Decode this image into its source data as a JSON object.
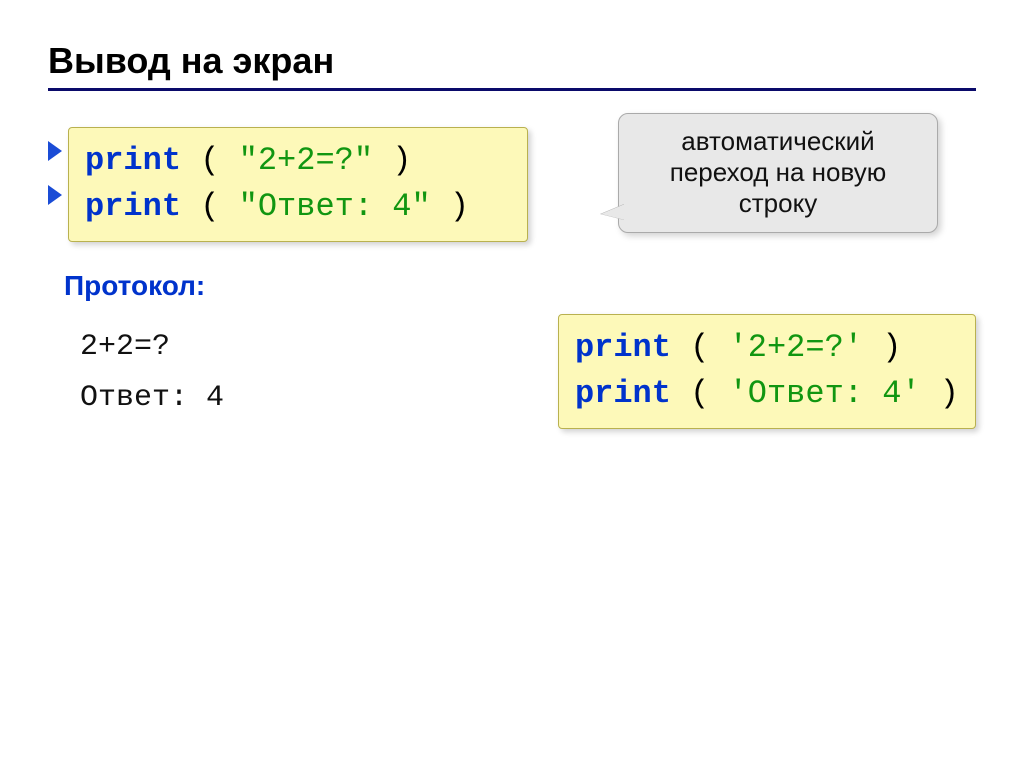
{
  "title": "Вывод на экран",
  "tooltip": "автоматический переход на новую строку",
  "code1": {
    "line1": {
      "kw": "print",
      "open": " ( ",
      "str": "\"2+2=?\"",
      "close": " )"
    },
    "line2": {
      "kw": "print",
      "open": " ( ",
      "str": "\"Ответ: 4\"",
      "close": " )"
    }
  },
  "protocol_label": "Протокол:",
  "output": {
    "line1": "2+2=?",
    "line2": "Ответ: 4"
  },
  "code2": {
    "line1": {
      "kw": "print",
      "open": " ( ",
      "str": "'2+2=?'",
      "close": " )"
    },
    "line2": {
      "kw": "print",
      "open": " ( ",
      "str": "'Ответ: 4'",
      "close": " )"
    }
  }
}
